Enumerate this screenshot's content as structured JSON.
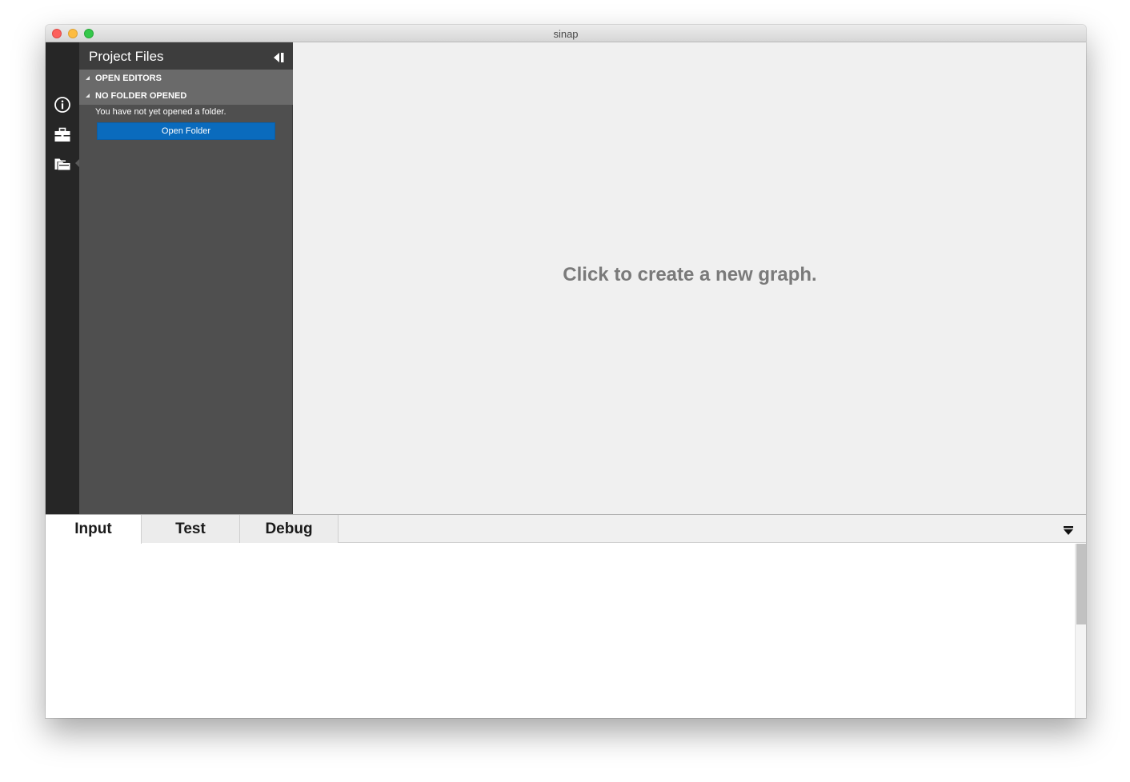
{
  "window": {
    "title": "sinap"
  },
  "activity_bar": {
    "icons": [
      "info-icon",
      "toolbox-icon",
      "folders-icon"
    ]
  },
  "sidebar": {
    "title": "Project Files",
    "sections": [
      {
        "label": "OPEN EDITORS"
      },
      {
        "label": "NO FOLDER OPENED"
      }
    ],
    "no_folder_message": "You have not yet opened a folder.",
    "open_folder_label": "Open Folder"
  },
  "editor": {
    "empty_message": "Click to create a new graph."
  },
  "panel": {
    "tabs": [
      {
        "label": "Input",
        "active": true
      },
      {
        "label": "Test",
        "active": false
      },
      {
        "label": "Debug",
        "active": false
      }
    ]
  },
  "colors": {
    "accent_button": "#0a6bbd",
    "activity_bar_bg": "#262626",
    "sidebar_bg": "#4f4f4f",
    "section_header_bg": "#6a6a6a",
    "editor_bg": "#f0f0f0"
  }
}
